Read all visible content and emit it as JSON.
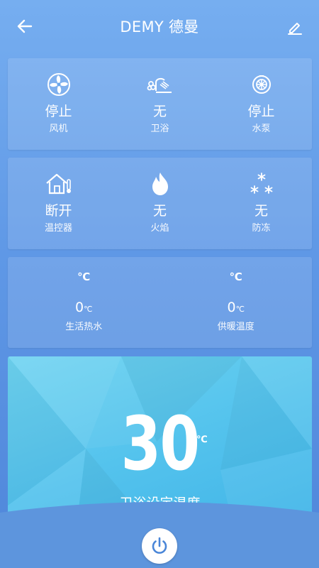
{
  "header": {
    "title": "DEMY 德曼",
    "back_icon": "arrow-left-icon",
    "edit_icon": "pencil-icon"
  },
  "status_row1": [
    {
      "icon": "fan-icon",
      "value": "停止",
      "label": "风机"
    },
    {
      "icon": "bath-icon",
      "value": "无",
      "label": "卫浴"
    },
    {
      "icon": "pump-icon",
      "value": "停止",
      "label": "水泵"
    }
  ],
  "status_row2": [
    {
      "icon": "home-thermostat-icon",
      "value": "断开",
      "label": "温控器"
    },
    {
      "icon": "flame-icon",
      "value": "无",
      "label": "火焰"
    },
    {
      "icon": "snowflake-icon",
      "value": "无",
      "label": "防冻"
    }
  ],
  "temps": [
    {
      "unit": "℃",
      "value": "0",
      "unit_small": "℃",
      "label": "生活热水"
    },
    {
      "unit": "℃",
      "value": "0",
      "unit_small": "℃",
      "label": "供暖温度"
    }
  ],
  "setpoint": {
    "value": "30",
    "unit": "℃",
    "label": "卫浴设定温度"
  },
  "power_icon": "power-icon",
  "colors": {
    "background": "#5f98e6",
    "setpoint_panel": "#54c3ed",
    "power_icon": "#4a86d8"
  }
}
